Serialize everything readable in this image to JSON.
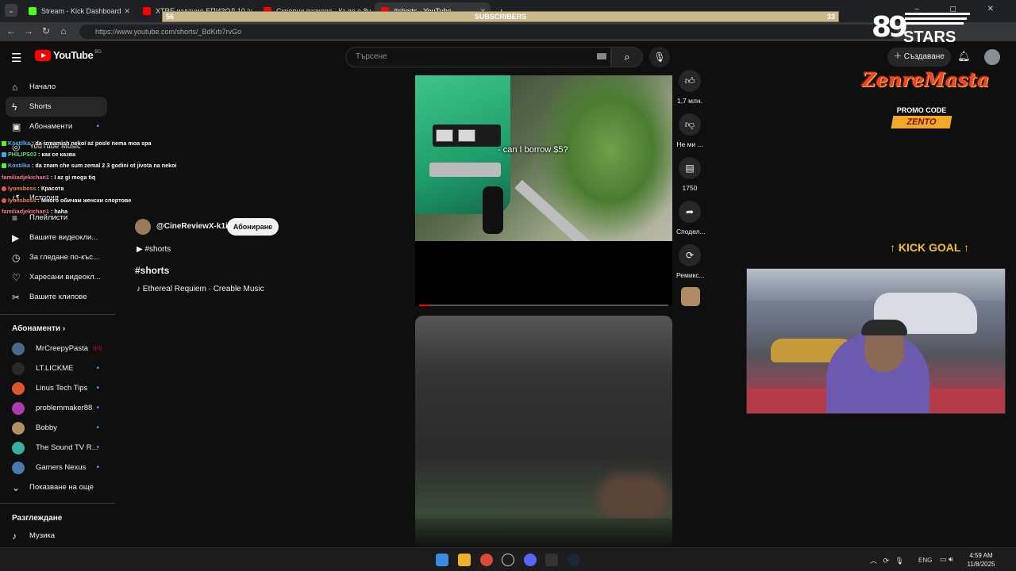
{
  "browser": {
    "tabs": [
      {
        "title": "Stream - Kick Dashboard",
        "fav_color": "#53fc18"
      },
      {
        "title": "XTRE издание ЕПИЗОД 10 ‘ч",
        "fav_color": "#ff0000"
      },
      {
        "title": "Скрепни пазкове - Къде е 3ч",
        "fav_color": "#ff0000"
      },
      {
        "title": "#shorts - YouTube",
        "fav_color": "#ff0000"
      }
    ],
    "url": "https://www.youtube.com/shorts/_BdKrb7rvGo",
    "window_controls": "– ◻ ✕"
  },
  "subscribers_bar": {
    "left": "56",
    "label": "SUBSCRIBERS",
    "right": "33",
    "fill_fraction": 1.0
  },
  "youtube": {
    "logo_text": "YouTube",
    "region": "BG",
    "search_placeholder": "Търсене",
    "create_label": "Създаване",
    "sidebar": {
      "main": [
        {
          "label": "Начало",
          "icon": "home-icon",
          "glyph": "⌂"
        },
        {
          "label": "Shorts",
          "icon": "shorts-icon",
          "glyph": "ϟ"
        },
        {
          "label": "Абонаменти",
          "icon": "subscriptions-icon",
          "glyph": "▣"
        }
      ],
      "you": [
        {
          "label": "YouTube Music",
          "icon": "music-icon",
          "glyph": "◎"
        },
        {
          "label": "История",
          "icon": "history-icon",
          "glyph": "↺"
        },
        {
          "label": "Плейлисти",
          "icon": "playlists-icon",
          "glyph": "≡"
        },
        {
          "label": "Вашите видеокли...",
          "icon": "your-videos-icon",
          "glyph": "▶"
        },
        {
          "label": "За гледане по-къс...",
          "icon": "watch-later-icon",
          "glyph": "◷"
        },
        {
          "label": "Харесани видеокл...",
          "icon": "liked-videos-icon",
          "glyph": "♡"
        },
        {
          "label": "Вашите клипове",
          "icon": "clips-icon",
          "glyph": "✂"
        }
      ],
      "subscriptions_header": "Абонаменти",
      "subscriptions": [
        {
          "name": "MrCreepyPasta",
          "color": "#4a6a8a",
          "status": "live"
        },
        {
          "name": "LT.LICKME",
          "color": "#2a2a2a",
          "status": "dot"
        },
        {
          "name": "Linus Tech Tips",
          "color": "#e0542a",
          "status": "dot"
        },
        {
          "name": "problemmaker88",
          "color": "#b03ab0",
          "status": "dot"
        },
        {
          "name": "Bobby",
          "color": "#b09060",
          "status": "dot"
        },
        {
          "name": "The Sound TV R...",
          "color": "#3ab0a0",
          "status": "dot"
        },
        {
          "name": "Gamers Nexus",
          "color": "#4a7ab0",
          "status": "dot"
        }
      ],
      "show_more": "Показване на още",
      "explore_header": "Разглеждане",
      "explore": [
        {
          "label": "Музика",
          "icon": "music-note-icon",
          "glyph": "♪"
        }
      ]
    },
    "short": {
      "channel": "@CineReviewX-k1i",
      "subscribe_label": "Абониране",
      "playlist": "#shorts",
      "title": "#shorts",
      "music": "Ethereal Requiem · Creable Music",
      "caption": "- can I borrow $5?",
      "progress": 0.04,
      "actions": [
        {
          "label": "1,7 млн.",
          "icon": "like-icon",
          "glyph": "👍︎"
        },
        {
          "label": "Не ми ...",
          "icon": "dislike-icon",
          "glyph": "👎︎"
        },
        {
          "label": "1750",
          "icon": "comments-icon",
          "glyph": "▤"
        },
        {
          "label": "Сподел...",
          "icon": "share-icon",
          "glyph": "➦"
        },
        {
          "label": "Ремикс...",
          "icon": "remix-icon",
          "glyph": "⟳"
        }
      ]
    }
  },
  "chat": [
    {
      "user": "Kostilka",
      "color": "#5ab4ff",
      "text": "da izmamish nekoi az posle nema moa spa"
    },
    {
      "user": "PHILIPS03",
      "color": "#6ee07a",
      "text": "как се казва"
    },
    {
      "user": "Kostilka",
      "color": "#5ab4ff",
      "text": "da znam che sum zemal 2 3 godini ot jivota na nekoi"
    },
    {
      "user": "familiadjekichan1",
      "color": "#ff7a9a",
      "text": "I az gi moga tiq"
    },
    {
      "user": "lyonsboss",
      "color": "#ff8a5a",
      "text": "Красота"
    },
    {
      "user": "lyonsboss",
      "color": "#ff8a5a",
      "text": "Много обичам женски спортове"
    },
    {
      "user": "familiadjekichan1",
      "color": "#ff7a9a",
      "text": "haha"
    }
  ],
  "overlay": {
    "stars_number": "89",
    "stars_text": "STARS",
    "promo_brand": "ZenreMasta",
    "promo_label": "PROMO CODE",
    "promo_code": "ZENTO",
    "kick_goal": "↑ KICK GOAL ↑"
  },
  "taskbar": {
    "lang": "ENG",
    "time": "4:59 AM",
    "date": "11/8/2025"
  }
}
